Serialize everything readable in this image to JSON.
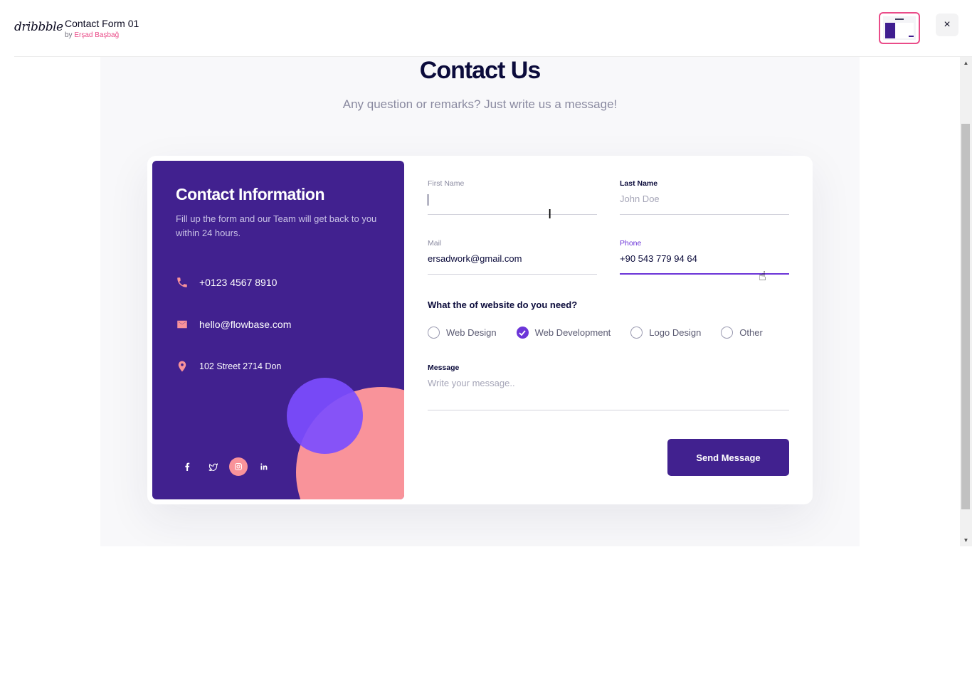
{
  "header": {
    "logo": "dribbble",
    "title": "Contact Form 01",
    "by_prefix": "by",
    "author": "Erşad Başbağ",
    "close_icon": "×"
  },
  "page": {
    "title": "Contact Us",
    "subtitle": "Any question or remarks? Just write us a message!"
  },
  "info": {
    "title": "Contact Information",
    "text": "Fill up the form and our Team will get back to you within 24 hours.",
    "phone": "+0123 4567 8910",
    "email": "hello@flowbase.com",
    "address": "102 Street 2714 Don",
    "socials": [
      "facebook-icon",
      "twitter-icon",
      "instagram-icon",
      "linkedin-icon"
    ]
  },
  "form": {
    "first_name": {
      "label": "First Name",
      "value": "",
      "placeholder": ""
    },
    "last_name": {
      "label": "Last Name",
      "value": "",
      "placeholder": "John Doe"
    },
    "mail": {
      "label": "Mail",
      "value": "ersadwork@gmail.com"
    },
    "phone": {
      "label": "Phone",
      "value": "+90 543 779 94 64"
    },
    "question": "What the of website do you need?",
    "options": [
      {
        "label": "Web Design",
        "checked": false
      },
      {
        "label": "Web Development",
        "checked": true
      },
      {
        "label": "Logo Design",
        "checked": false
      },
      {
        "label": "Other",
        "checked": false
      }
    ],
    "message": {
      "label": "Message",
      "placeholder": "Write your message.."
    },
    "send_label": "Send Message"
  },
  "colors": {
    "primary": "#41218f",
    "accent": "#6c35d8",
    "pink": "#f9939a",
    "brand_pink": "#ea4c89"
  }
}
